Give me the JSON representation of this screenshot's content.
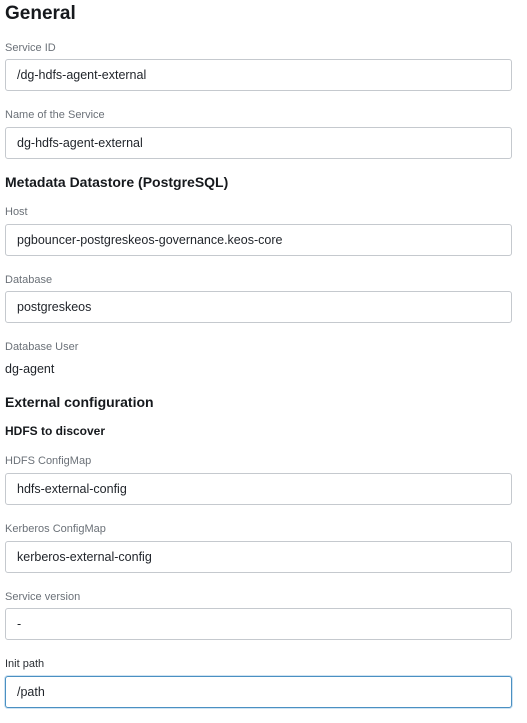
{
  "sections": {
    "general_title": "General",
    "metadata_title": "Metadata Datastore (PostgreSQL)",
    "external_title": "External configuration",
    "hdfs_subtitle": "HDFS to discover"
  },
  "fields": {
    "service_id": {
      "label": "Service ID",
      "value": "/dg-hdfs-agent-external"
    },
    "service_name": {
      "label": "Name of the Service",
      "value": "dg-hdfs-agent-external"
    },
    "host": {
      "label": "Host",
      "value": "pgbouncer-postgreskeos-governance.keos-core"
    },
    "database": {
      "label": "Database",
      "value": "postgreskeos"
    },
    "database_user": {
      "label": "Database User",
      "value": "dg-agent"
    },
    "hdfs_configmap": {
      "label": "HDFS ConfigMap",
      "value": "hdfs-external-config"
    },
    "kerberos_configmap": {
      "label": "Kerberos ConfigMap",
      "value": "kerberos-external-config"
    },
    "service_version": {
      "label": "Service version",
      "value": "-"
    },
    "init_path": {
      "label": "Init path",
      "value": "/path"
    }
  },
  "colors": {
    "input_border": "#c5c9ce",
    "focused_border": "#4a90c2",
    "label_text": "#6b7178",
    "heading_text": "#16191d"
  }
}
